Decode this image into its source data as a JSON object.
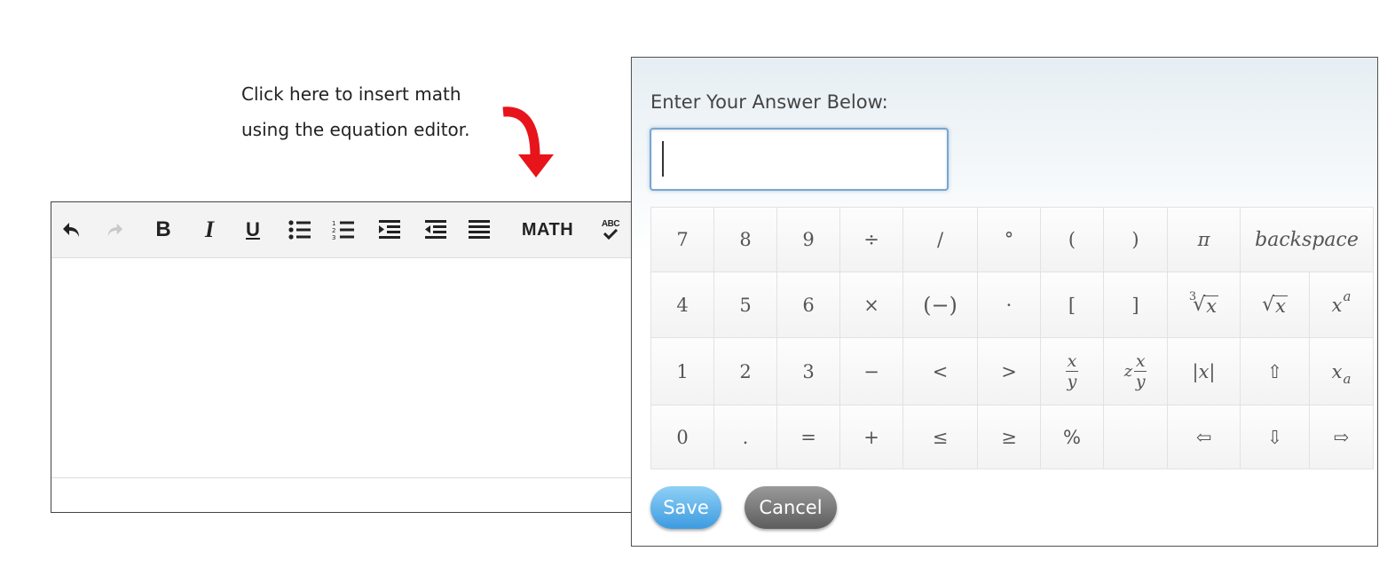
{
  "annotation": {
    "line1": "Click here to insert math",
    "line2": "using the equation editor.",
    "arrow_color": "#e8141b"
  },
  "editor": {
    "toolbar": {
      "undo_icon": "undo-icon",
      "redo_icon": "redo-icon",
      "bold_label": "B",
      "italic_label": "I",
      "underline_label": "U",
      "bullet_list_icon": "bullet-list-icon",
      "numbered_list_icon": "numbered-list-icon",
      "indent_icon": "indent-icon",
      "outdent_icon": "outdent-icon",
      "justify_icon": "justify-icon",
      "math_label": "MATH",
      "spellcheck_icon": "spellcheck-icon",
      "spellcheck_text": "ABC"
    },
    "content": ""
  },
  "dialog": {
    "title": "Enter Your Answer Below:",
    "answer_value": "",
    "keypad": {
      "rows": [
        [
          "7",
          "8",
          "9",
          "÷",
          "/",
          "°",
          "(",
          ")",
          "π",
          "backspace"
        ],
        [
          "4",
          "5",
          "6",
          "×",
          "(−)",
          "·",
          "[",
          "]",
          "∛x",
          "√x",
          "xᵃ"
        ],
        [
          "1",
          "2",
          "3",
          "−",
          "<",
          ">",
          "x/y",
          "z x/y",
          "|x|",
          "⇧",
          "xₐ"
        ],
        [
          "0",
          ".",
          "=",
          "+",
          "≤",
          "≥",
          "%",
          "",
          "⇦",
          "⇩",
          "⇨"
        ]
      ]
    },
    "save_label": "Save",
    "cancel_label": "Cancel",
    "accent": "#3d9be0"
  }
}
